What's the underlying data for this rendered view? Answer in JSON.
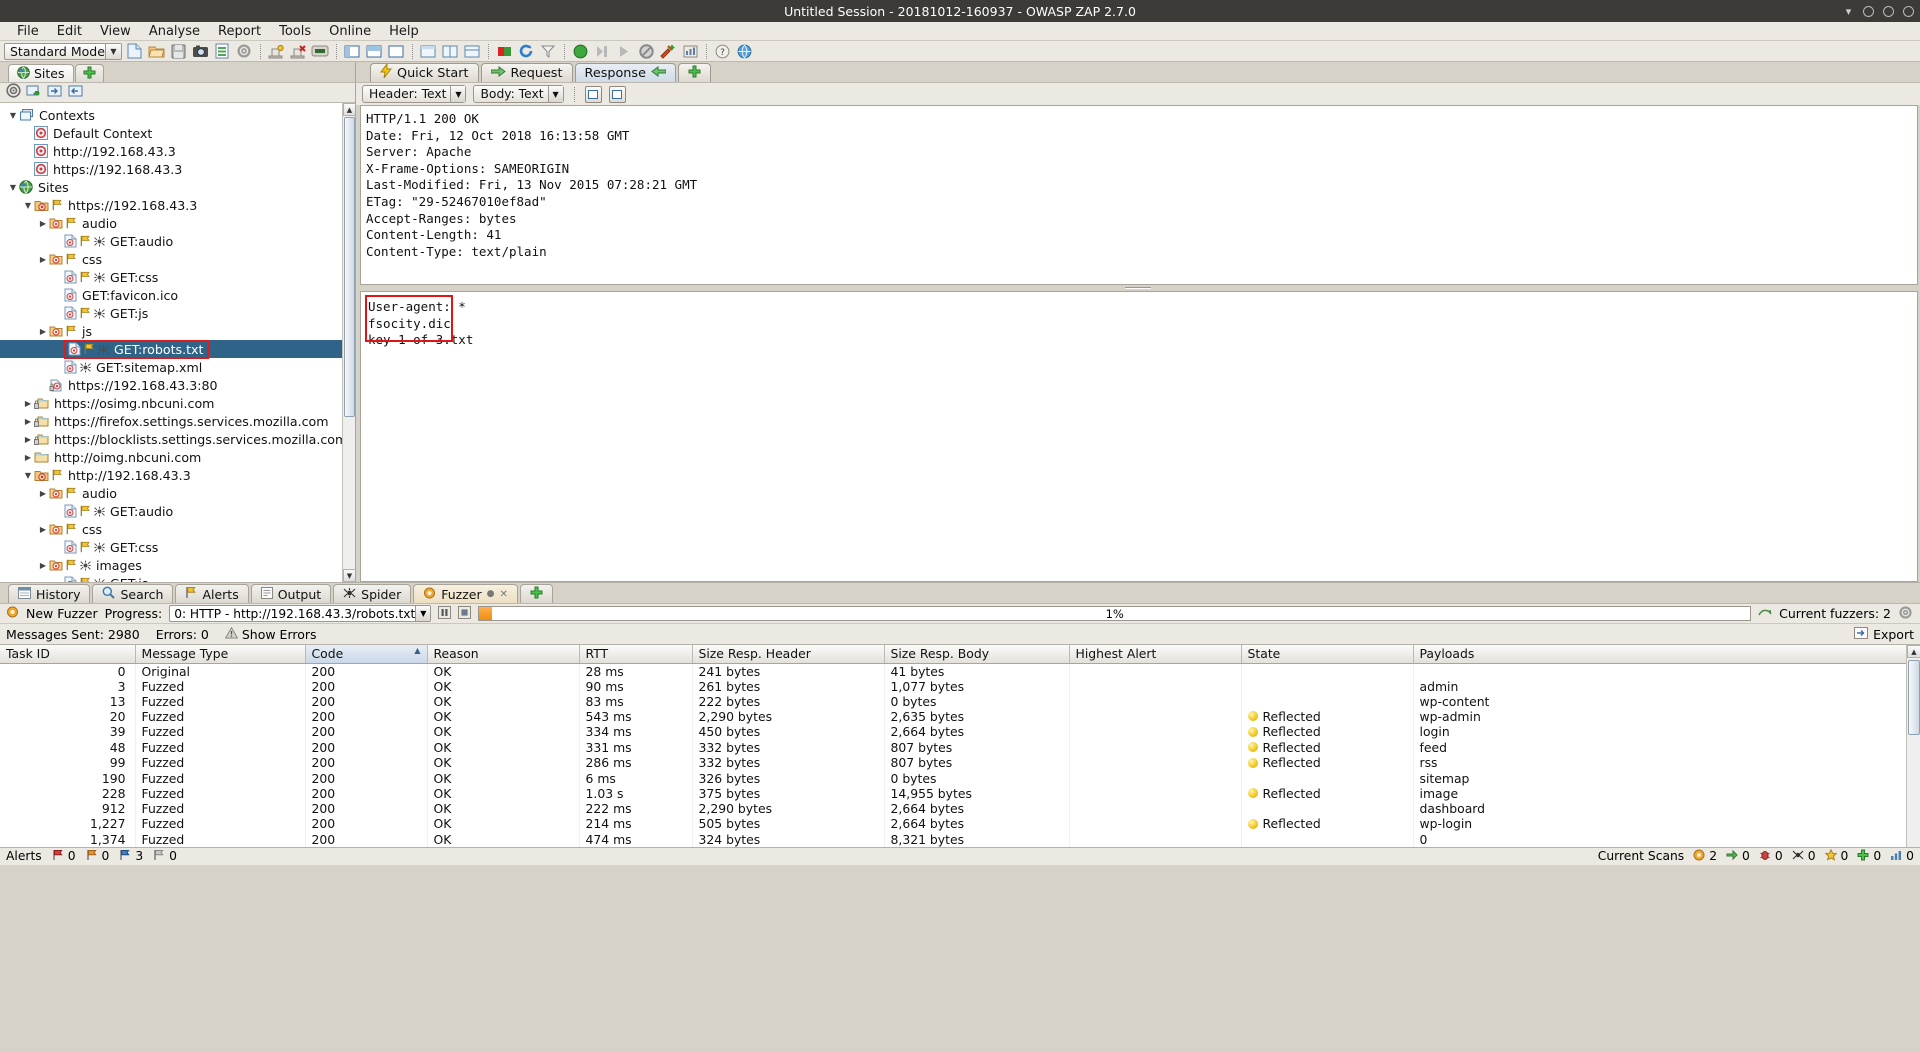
{
  "window": {
    "title": "Untitled Session - 20181012-160937 - OWASP ZAP 2.7.0"
  },
  "menu": {
    "items": [
      "File",
      "Edit",
      "View",
      "Analyse",
      "Report",
      "Tools",
      "Online",
      "Help"
    ]
  },
  "toolbar": {
    "mode_label": "Standard Mode",
    "icons": [
      "new-session-icon",
      "open-session-icon",
      "save-session-icon",
      "snapshot-icon",
      "session-properties-icon",
      "options-icon",
      "manage-addons-icon",
      "remove-addon-icon",
      "scan-policy-icon",
      "expand-layout-icon",
      "split-layout-icon",
      "full-layout-icon",
      "panel-layout-1-icon",
      "panel-layout-2-icon",
      "panel-layout-3-icon",
      "stop-icon",
      "refresh-icon",
      "filter-icon",
      "start-icon",
      "step-icon",
      "continue-icon",
      "break-icon",
      "attack-icon",
      "stats-icon",
      "help-icon",
      "browser-icon"
    ]
  },
  "sites_panel": {
    "tab_label": "Sites",
    "plus_label": "+",
    "toolbar_icons": [
      "scope-icon",
      "new-context-icon",
      "import-icon",
      "export-icon"
    ],
    "tree": [
      {
        "depth": 0,
        "toggle": "open",
        "icon": "contexts-icon",
        "label": "Contexts"
      },
      {
        "depth": 1,
        "toggle": "none",
        "icon": "context-icon",
        "label": "Default Context"
      },
      {
        "depth": 1,
        "toggle": "none",
        "icon": "context-icon",
        "label": "http://192.168.43.3"
      },
      {
        "depth": 1,
        "toggle": "none",
        "icon": "context-icon",
        "label": "https://192.168.43.3"
      },
      {
        "depth": 0,
        "toggle": "open",
        "icon": "sites-globe-icon",
        "label": "Sites"
      },
      {
        "depth": 1,
        "toggle": "open",
        "icon": "site-folder-lock-icon",
        "flag": true,
        "label": "https://192.168.43.3"
      },
      {
        "depth": 2,
        "toggle": "closed",
        "icon": "folder-node-icon",
        "flag": true,
        "label": "audio"
      },
      {
        "depth": 3,
        "toggle": "none",
        "icon": "leaf-node-icon",
        "flag": true,
        "spider": true,
        "label": "GET:audio"
      },
      {
        "depth": 2,
        "toggle": "closed",
        "icon": "folder-node-icon",
        "flag": true,
        "label": "css"
      },
      {
        "depth": 3,
        "toggle": "none",
        "icon": "leaf-node-icon",
        "flag": true,
        "spider": true,
        "label": "GET:css"
      },
      {
        "depth": 3,
        "toggle": "none",
        "icon": "leaf-node-icon",
        "label": "GET:favicon.ico"
      },
      {
        "depth": 3,
        "toggle": "none",
        "icon": "leaf-node-icon",
        "flag": true,
        "spider": true,
        "label": "GET:js"
      },
      {
        "depth": 2,
        "toggle": "closed",
        "icon": "folder-node-icon",
        "flag": true,
        "label": "js"
      },
      {
        "depth": 3,
        "toggle": "none",
        "icon": "leaf-node-icon",
        "flag": true,
        "spider": true,
        "label": "GET:robots.txt",
        "selected": true,
        "highlight": true
      },
      {
        "depth": 3,
        "toggle": "none",
        "icon": "leaf-node-icon",
        "spider": true,
        "label": "GET:sitemap.xml"
      },
      {
        "depth": 2,
        "toggle": "none",
        "icon": "site-lock-icon",
        "label": "https://192.168.43.3:80"
      },
      {
        "depth": 1,
        "toggle": "closed",
        "icon": "folder-lock-icon",
        "label": "https://osimg.nbcuni.com"
      },
      {
        "depth": 1,
        "toggle": "closed",
        "icon": "folder-lock-icon",
        "label": "https://firefox.settings.services.mozilla.com"
      },
      {
        "depth": 1,
        "toggle": "closed",
        "icon": "folder-lock-icon",
        "label": "https://blocklists.settings.services.mozilla.com"
      },
      {
        "depth": 1,
        "toggle": "closed",
        "icon": "folder-plain-icon",
        "label": "http://oimg.nbcuni.com"
      },
      {
        "depth": 1,
        "toggle": "open",
        "icon": "site-folder-lock-icon",
        "flag": true,
        "label": "http://192.168.43.3"
      },
      {
        "depth": 2,
        "toggle": "closed",
        "icon": "folder-node-icon",
        "flag": true,
        "label": "audio"
      },
      {
        "depth": 3,
        "toggle": "none",
        "icon": "leaf-node-icon",
        "flag": true,
        "spider": true,
        "label": "GET:audio"
      },
      {
        "depth": 2,
        "toggle": "closed",
        "icon": "folder-node-icon",
        "flag": true,
        "label": "css"
      },
      {
        "depth": 3,
        "toggle": "none",
        "icon": "leaf-node-icon",
        "flag": true,
        "spider": true,
        "label": "GET:css"
      },
      {
        "depth": 2,
        "toggle": "closed",
        "icon": "folder-node-icon",
        "flag": true,
        "spider": true,
        "label": "images"
      },
      {
        "depth": 3,
        "toggle": "none",
        "icon": "leaf-node-icon",
        "flag": true,
        "spider": true,
        "label": "GET:js"
      }
    ]
  },
  "request_panel": {
    "tabs": [
      {
        "label": "Quick Start",
        "icon": "lightning-icon",
        "active": false
      },
      {
        "label": "Request",
        "icon": "arrow-right-icon",
        "active": false
      },
      {
        "label": "Response",
        "icon": "arrow-left-icon",
        "active": true
      },
      {
        "label": "+",
        "icon": "plus-icon",
        "active": false
      }
    ],
    "header_combo": "Header: Text",
    "body_combo": "Body: Text",
    "view_buttons": [
      "split-view-icon",
      "single-view-icon"
    ],
    "response_header": "HTTP/1.1 200 OK\nDate: Fri, 12 Oct 2018 16:13:58 GMT\nServer: Apache\nX-Frame-Options: SAMEORIGIN\nLast-Modified: Fri, 13 Nov 2015 07:28:21 GMT\nETag: \"29-52467010ef8ad\"\nAccept-Ranges: bytes\nContent-Length: 41\nContent-Type: text/plain",
    "response_body": "User-agent: *\nfsocity.dic\nkey-1-of-3.txt"
  },
  "bottom_tabs": [
    {
      "label": "History",
      "icon": "history-icon",
      "active": false
    },
    {
      "label": "Search",
      "icon": "search-icon",
      "active": false
    },
    {
      "label": "Alerts",
      "icon": "alert-flag-icon",
      "active": false
    },
    {
      "label": "Output",
      "icon": "output-icon",
      "active": false
    },
    {
      "label": "Spider",
      "icon": "spider-icon",
      "active": false
    },
    {
      "label": "Fuzzer",
      "icon": "fuzzer-icon",
      "active": true
    },
    {
      "label": "+",
      "icon": "plus-icon",
      "active": false
    }
  ],
  "fuzzer": {
    "new_fuzzer_label": "New Fuzzer",
    "progress_label": "Progress:",
    "progress_value": "0: HTTP - http://192.168.43.3/robots.txt",
    "progress_percent": "1%",
    "progress_percent_num": 1,
    "current_fuzzers_label": "Current fuzzers: 2",
    "pause_icon": "pause-icon",
    "stop_icon": "stop-icon",
    "messages_sent": "Messages Sent: 2980",
    "errors": "Errors: 0",
    "show_errors": "Show Errors",
    "export_label": "Export",
    "options_icon": "options-gear-icon",
    "columns": [
      "Task ID",
      "Message Type",
      "Code",
      "Reason",
      "RTT",
      "Size Resp. Header",
      "Size Resp. Body",
      "Highest Alert",
      "State",
      "Payloads"
    ],
    "sorted_column": "Code",
    "rows": [
      {
        "task_id": "0",
        "message_type": "Original",
        "code": "200",
        "reason": "OK",
        "rtt": "28 ms",
        "size_header": "241 bytes",
        "size_body": "41 bytes",
        "highest_alert": "",
        "state": "",
        "payloads": ""
      },
      {
        "task_id": "3",
        "message_type": "Fuzzed",
        "code": "200",
        "reason": "OK",
        "rtt": "90 ms",
        "size_header": "261 bytes",
        "size_body": "1,077 bytes",
        "highest_alert": "",
        "state": "",
        "payloads": "admin"
      },
      {
        "task_id": "13",
        "message_type": "Fuzzed",
        "code": "200",
        "reason": "OK",
        "rtt": "83 ms",
        "size_header": "222 bytes",
        "size_body": "0 bytes",
        "highest_alert": "",
        "state": "",
        "payloads": "wp-content"
      },
      {
        "task_id": "20",
        "message_type": "Fuzzed",
        "code": "200",
        "reason": "OK",
        "rtt": "543 ms",
        "size_header": "2,290 bytes",
        "size_body": "2,635 bytes",
        "highest_alert": "",
        "state": "Reflected",
        "payloads": "wp-admin"
      },
      {
        "task_id": "39",
        "message_type": "Fuzzed",
        "code": "200",
        "reason": "OK",
        "rtt": "334 ms",
        "size_header": "450 bytes",
        "size_body": "2,664 bytes",
        "highest_alert": "",
        "state": "Reflected",
        "payloads": "login"
      },
      {
        "task_id": "48",
        "message_type": "Fuzzed",
        "code": "200",
        "reason": "OK",
        "rtt": "331 ms",
        "size_header": "332 bytes",
        "size_body": "807 bytes",
        "highest_alert": "",
        "state": "Reflected",
        "payloads": "feed"
      },
      {
        "task_id": "99",
        "message_type": "Fuzzed",
        "code": "200",
        "reason": "OK",
        "rtt": "286 ms",
        "size_header": "332 bytes",
        "size_body": "807 bytes",
        "highest_alert": "",
        "state": "Reflected",
        "payloads": "rss"
      },
      {
        "task_id": "190",
        "message_type": "Fuzzed",
        "code": "200",
        "reason": "OK",
        "rtt": "6 ms",
        "size_header": "326 bytes",
        "size_body": "0 bytes",
        "highest_alert": "",
        "state": "",
        "payloads": "sitemap"
      },
      {
        "task_id": "228",
        "message_type": "Fuzzed",
        "code": "200",
        "reason": "OK",
        "rtt": "1.03 s",
        "size_header": "375 bytes",
        "size_body": "14,955 bytes",
        "highest_alert": "",
        "state": "Reflected",
        "payloads": "image"
      },
      {
        "task_id": "912",
        "message_type": "Fuzzed",
        "code": "200",
        "reason": "OK",
        "rtt": "222 ms",
        "size_header": "2,290 bytes",
        "size_body": "2,664 bytes",
        "highest_alert": "",
        "state": "",
        "payloads": "dashboard"
      },
      {
        "task_id": "1,227",
        "message_type": "Fuzzed",
        "code": "200",
        "reason": "OK",
        "rtt": "214 ms",
        "size_header": "505 bytes",
        "size_body": "2,664 bytes",
        "highest_alert": "",
        "state": "Reflected",
        "payloads": "wp-login"
      },
      {
        "task_id": "1,374",
        "message_type": "Fuzzed",
        "code": "200",
        "reason": "OK",
        "rtt": "474 ms",
        "size_header": "324 bytes",
        "size_body": "8,321 bytes",
        "highest_alert": "",
        "state": "",
        "payloads": "0"
      }
    ]
  },
  "statusbar": {
    "alerts_label": "Alerts",
    "counts": [
      {
        "level": "red",
        "value": "0"
      },
      {
        "level": "orange",
        "value": "0"
      },
      {
        "level": "blue",
        "value": "3"
      },
      {
        "level": "grey",
        "value": "0"
      }
    ],
    "current_scans_label": "Current Scans",
    "scan_counts": [
      {
        "icon": "scan-circle-orange",
        "value": "2"
      },
      {
        "icon": "scan-arrow-green",
        "value": "0"
      },
      {
        "icon": "scan-bug-red",
        "value": "0"
      },
      {
        "icon": "scan-spider-black",
        "value": "0"
      },
      {
        "icon": "scan-star-yellow",
        "value": "0"
      },
      {
        "icon": "scan-plus-green",
        "value": "0"
      },
      {
        "icon": "scan-bar-blue",
        "value": "0"
      }
    ]
  }
}
